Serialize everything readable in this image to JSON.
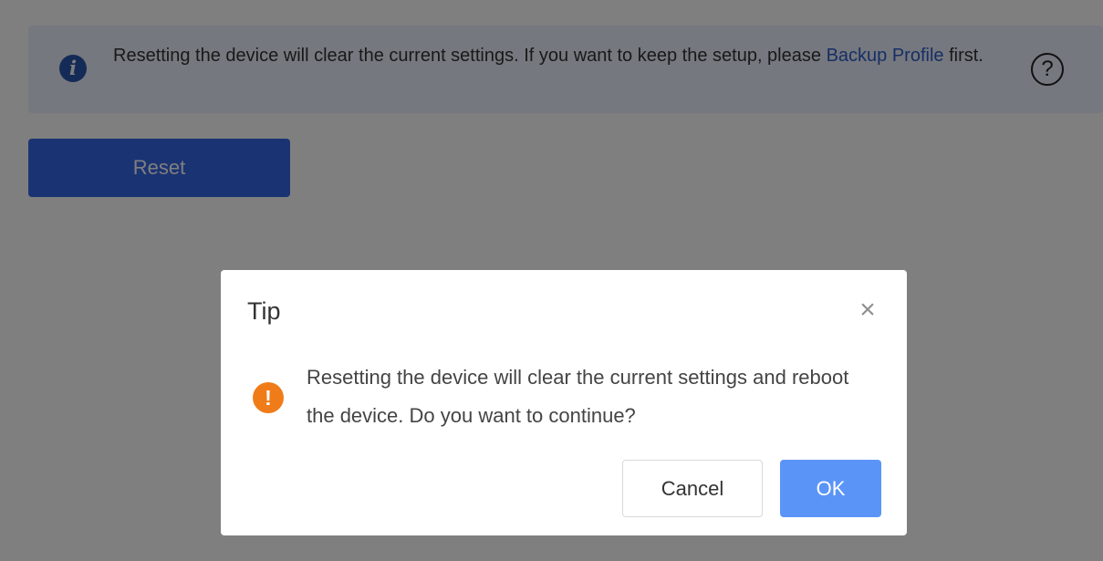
{
  "banner": {
    "icon": "info-icon",
    "icon_glyph": "i",
    "text_before_link": "Resetting the device will clear the current settings. If you want to keep the setup, please",
    "link_text": "Backup Profile",
    "text_after_link": "first.",
    "help_icon": "help-circle-icon",
    "help_glyph": "?",
    "background_color": "#eaf1fd",
    "link_color": "#2e5ccc"
  },
  "main": {
    "reset_label": "Reset",
    "reset_color": "#3566e6"
  },
  "dialog": {
    "title": "Tip",
    "close_icon": "close-icon",
    "close_glyph": "×",
    "warning_icon": "warning-icon",
    "warning_glyph": "!",
    "message": "Resetting the device will clear the current settings and reboot the device. Do you want to continue?",
    "cancel_label": "Cancel",
    "ok_label": "OK",
    "ok_color": "#5b94f7",
    "warning_color": "#f07c19"
  }
}
